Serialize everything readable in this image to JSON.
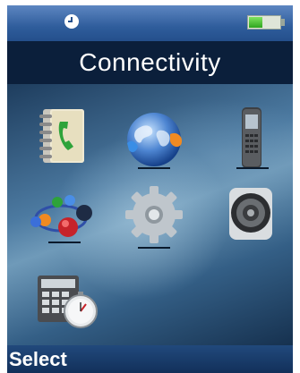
{
  "status_bar": {
    "alarm_icon": "clock-icon",
    "battery_icon": "battery-icon",
    "battery_level": 0.45
  },
  "header": {
    "title": "Connectivity"
  },
  "menu": {
    "items": [
      {
        "icon": "phonebook-icon"
      },
      {
        "icon": "globe-network-icon"
      },
      {
        "icon": "handset-icon"
      },
      {
        "icon": "connected-nodes-icon"
      },
      {
        "icon": "gear-icon"
      },
      {
        "icon": "speaker-icon"
      },
      {
        "icon": "calculator-stopwatch-icon"
      }
    ]
  },
  "softkeys": {
    "left": "Select"
  },
  "colors": {
    "status_bar": "#2f5d9c",
    "title_bar": "#0b1f3b",
    "softkey_bar": "#12305a",
    "text": "#ffffff"
  }
}
